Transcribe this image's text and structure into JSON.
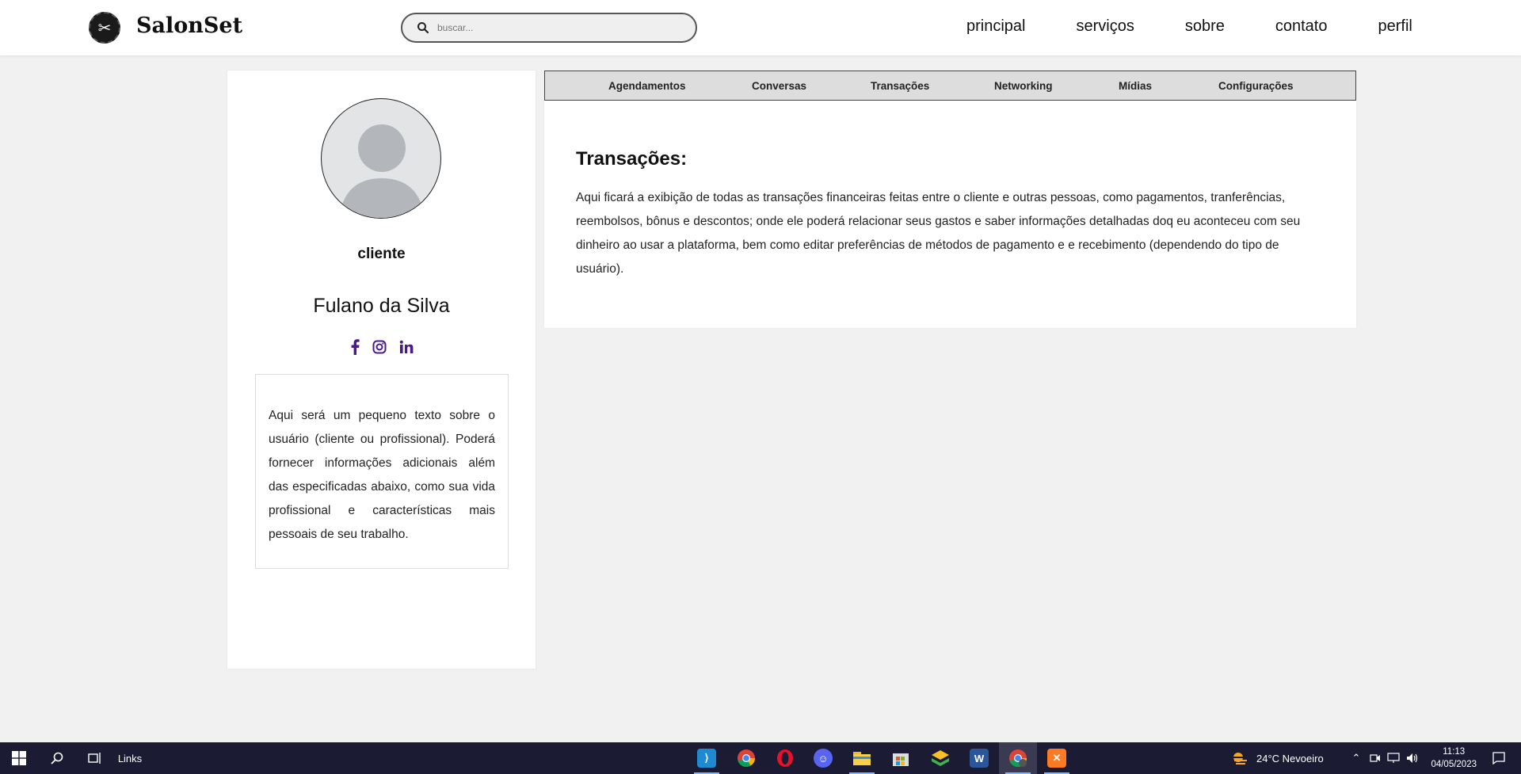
{
  "header": {
    "brand": "SalonSet",
    "search_placeholder": "buscar...",
    "nav": [
      "principal",
      "serviços",
      "sobre",
      "contato",
      "perfil"
    ]
  },
  "profile": {
    "role": "cliente",
    "name": "Fulano da Silva",
    "social_icons": [
      "facebook-icon",
      "instagram-icon",
      "linkedin-icon"
    ],
    "bio": "Aqui será um pequeno texto sobre o usuário (cliente ou profissional). Poderá fornecer informações adicionais além das especificadas abaixo, como sua vida profissional e características mais pessoais de seu trabalho."
  },
  "tabs": [
    "Agendamentos",
    "Conversas",
    "Transações",
    "Networking",
    "Mídias",
    "Configurações"
  ],
  "content": {
    "title": "Transações:",
    "body": "Aqui ficará a exibição de todas as transações financeiras feitas entre o cliente e outras pessoas, como pagamentos, tranferências, reembolsos, bônus e descontos; onde ele poderá relacionar seus gastos e saber informações detalhadas doq eu aconteceu com seu dinheiro ao usar a plataforma, bem como editar preferências de métodos de pagamento e e recebimento (dependendo do tipo de usuário)."
  },
  "taskbar": {
    "links_label": "Links",
    "weather": "24°C  Nevoeiro",
    "time": "11:13",
    "date": "04/05/2023",
    "apps": [
      "vscode-icon",
      "chrome-icon",
      "opera-icon",
      "discord-icon",
      "file-explorer-icon",
      "store-icon",
      "bluestacks-icon",
      "word-icon",
      "chrome-profile-icon",
      "xampp-icon"
    ]
  },
  "colors": {
    "accent_social": "#4a1a8a",
    "taskbar_bg": "#1b1c33",
    "tab_bar_bg": "#dddddd"
  }
}
